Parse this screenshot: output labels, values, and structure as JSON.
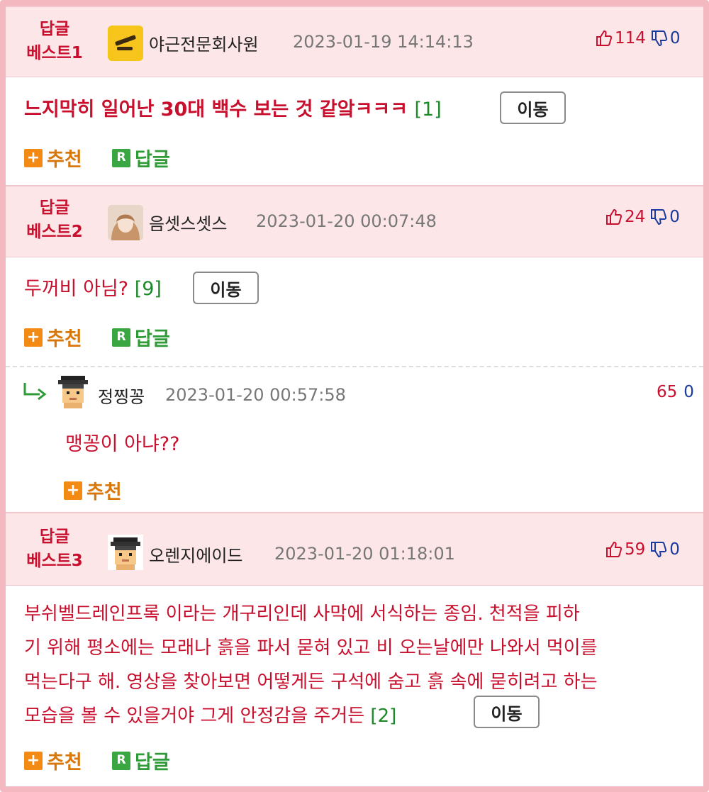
{
  "comments": [
    {
      "best_label": "답글\n베스트1",
      "best_label_line1": "답글",
      "best_label_line2": "베스트1",
      "nickname": "야근전문회사원",
      "date": "2023-01-19 14:14:13",
      "up": "114",
      "down": "0",
      "text": "느지막히 일어난 30대 백수 보는 것 같앜ㅋㅋㅋ",
      "reply_count": "[1]",
      "move_label": "이동",
      "recommend_label": "추천",
      "reply_label": "답글"
    },
    {
      "best_label_line1": "답글",
      "best_label_line2": "베스트2",
      "nickname": "음셋스셋스",
      "date": "2023-01-20 00:07:48",
      "up": "24",
      "down": "0",
      "text": "두꺼비 아님?",
      "reply_count": "[9]",
      "move_label": "이동",
      "recommend_label": "추천",
      "reply_label": "답글"
    },
    {
      "best_label_line1": "답글",
      "best_label_line2": "베스트3",
      "nickname": "오렌지에이드",
      "date": "2023-01-20 01:18:01",
      "up": "59",
      "down": "0",
      "text_line1": "부쉬벨드레인프록 이라는 개구리인데 사막에 서식하는 종임. 천적을 피하",
      "text_line2": "기 위해 평소에는 모래나 흙을 파서 묻혀 있고 비 오는날에만 나와서 먹이를",
      "text_line3": "먹는다구 해. 영상을 찾아보면 어떻게든 구석에 숨고 흙 속에 묻히려고 하는",
      "text_line4": "모습을 볼 수 있을거야 그게 안정감을 주거든",
      "reply_count": "[2]",
      "move_label": "이동",
      "recommend_label": "추천",
      "reply_label": "답글"
    }
  ],
  "reply": {
    "nickname": "정찡꽁",
    "date": "2023-01-20 00:57:58",
    "up": "65",
    "down": "0",
    "text": "맹꽁이 아냐??",
    "recommend_label": "추천"
  },
  "icons": {
    "thumb_up": "thumbs-up-icon",
    "thumb_down": "thumbs-down-icon",
    "plus": "plus-icon",
    "reply_r": "reply-r-icon",
    "reply_arrow": "reply-arrow-icon"
  },
  "colors": {
    "accent_red": "#c8102e",
    "header_pink": "#fce6e8",
    "frame_pink": "#f4b8c0",
    "recommend_orange": "#f28a14",
    "reply_green": "#3aa641",
    "down_blue": "#1a3a9e"
  }
}
